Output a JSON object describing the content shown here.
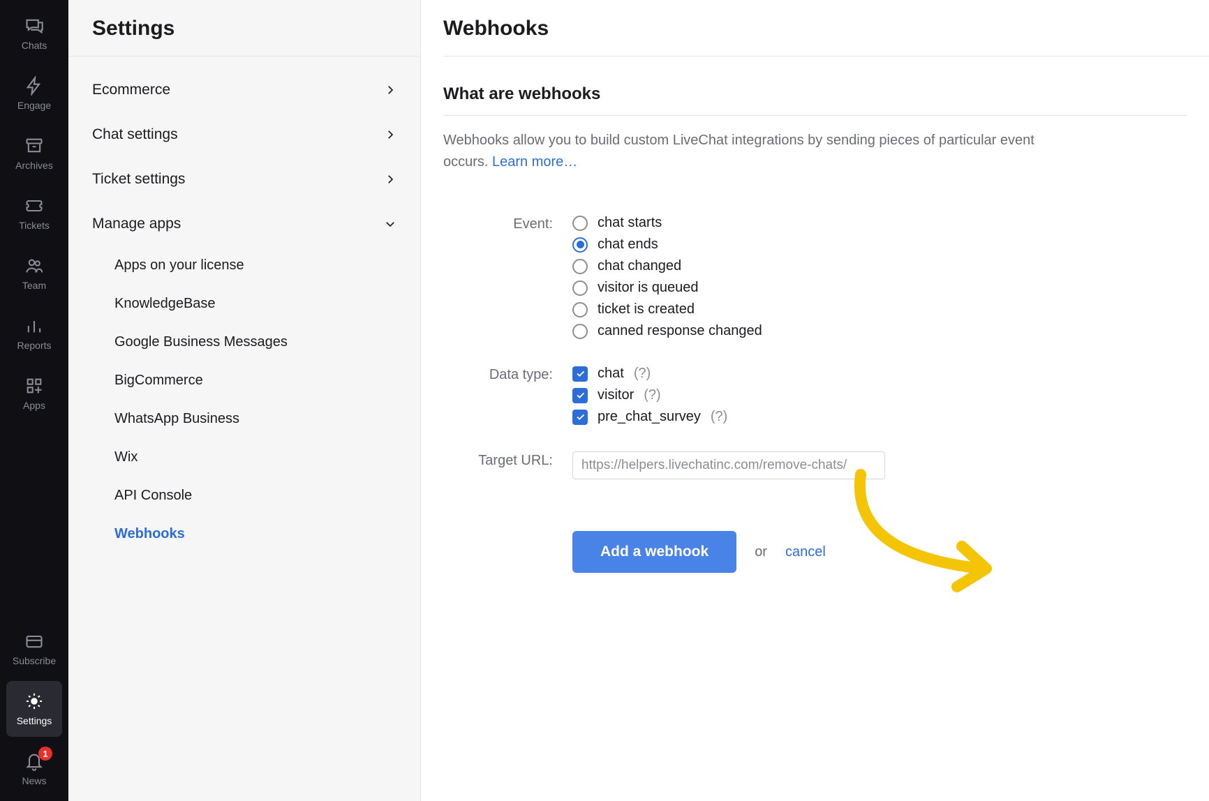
{
  "rail": {
    "items": [
      {
        "id": "chats",
        "label": "Chats"
      },
      {
        "id": "engage",
        "label": "Engage"
      },
      {
        "id": "archives",
        "label": "Archives"
      },
      {
        "id": "tickets",
        "label": "Tickets"
      },
      {
        "id": "team",
        "label": "Team"
      },
      {
        "id": "reports",
        "label": "Reports"
      },
      {
        "id": "apps",
        "label": "Apps"
      },
      {
        "id": "subscribe",
        "label": "Subscribe"
      },
      {
        "id": "settings",
        "label": "Settings"
      },
      {
        "id": "news",
        "label": "News",
        "badge": "1"
      }
    ]
  },
  "sidebar": {
    "title": "Settings",
    "rows": [
      {
        "label": "Ecommerce"
      },
      {
        "label": "Chat settings"
      },
      {
        "label": "Ticket settings"
      },
      {
        "label": "Manage apps"
      }
    ],
    "sub": [
      {
        "label": "Apps on your license"
      },
      {
        "label": "KnowledgeBase"
      },
      {
        "label": "Google Business Messages"
      },
      {
        "label": "BigCommerce"
      },
      {
        "label": "WhatsApp Business"
      },
      {
        "label": "Wix"
      },
      {
        "label": "API Console"
      },
      {
        "label": "Webhooks"
      }
    ]
  },
  "main": {
    "title": "Webhooks",
    "section_title": "What are webhooks",
    "desc_text": "Webhooks allow you to build custom LiveChat integrations by sending pieces of particular event occurs. ",
    "learn_more": "Learn more…",
    "event_label": "Event:",
    "events": [
      {
        "label": "chat starts"
      },
      {
        "label": "chat ends"
      },
      {
        "label": "chat changed"
      },
      {
        "label": "visitor is queued"
      },
      {
        "label": "ticket is created"
      },
      {
        "label": "canned response changed"
      }
    ],
    "datatype_label": "Data type:",
    "datatypes": [
      {
        "label": "chat",
        "help": "(?)"
      },
      {
        "label": "visitor",
        "help": "(?)"
      },
      {
        "label": "pre_chat_survey",
        "help": "(?)"
      }
    ],
    "target_label": "Target URL:",
    "target_value": "https://helpers.livechatinc.com/remove-chats/",
    "add_button": "Add a webhook",
    "or_text": "or",
    "cancel": "cancel"
  }
}
